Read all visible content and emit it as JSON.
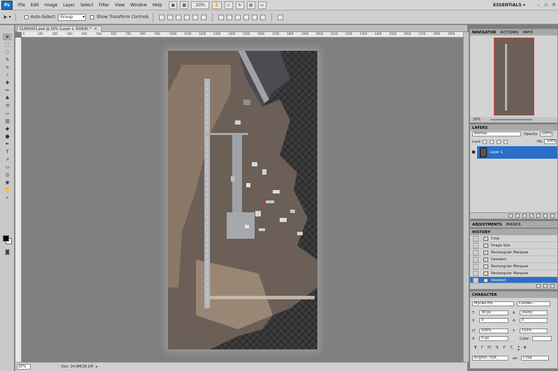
{
  "app": {
    "logo": "Ps"
  },
  "menu": [
    "File",
    "Edit",
    "Image",
    "Layer",
    "Select",
    "Filter",
    "View",
    "Window",
    "Help"
  ],
  "toolbar": {
    "zoom": "20%",
    "workspace": "ESSENTIALS",
    "workspace_arrow": "▾",
    "minimize": "–",
    "maximize": "▫",
    "close": "✕"
  },
  "options": {
    "auto_select_label": "Auto-Select:",
    "auto_select_value": "Group",
    "show_transform_label": "Show Transform Controls"
  },
  "document": {
    "tab_title": "ULKK0001.psd @ 20% (Layer 1, RGB/8) *",
    "ruler_marks": [
      "0",
      "100",
      "200",
      "300",
      "400",
      "500",
      "600",
      "700",
      "800",
      "900",
      "1000",
      "1100",
      "1200",
      "1300",
      "1400",
      "1500",
      "1600",
      "1700",
      "1800",
      "1900",
      "2000",
      "2100",
      "2200",
      "2300",
      "2400",
      "2500",
      "2600",
      "2700",
      "2800",
      "2900"
    ]
  },
  "status": {
    "zoom": "20%",
    "doc": "Doc: 24.9M/28.1M"
  },
  "navigator": {
    "tabs": [
      "NAVIGATOR",
      "ACTIONS",
      "INFO"
    ],
    "zoom": "20%"
  },
  "layers": {
    "tabs": [
      "LAYERS"
    ],
    "blend_mode": "Normal",
    "opacity_label": "Opacity:",
    "opacity_value": "100%",
    "lock_label": "Lock:",
    "fill_label": "Fill:",
    "fill_value": "100%",
    "items": [
      {
        "name": "Layer 1"
      }
    ]
  },
  "adjustments": {
    "tabs": [
      "ADJUSTMENTS",
      "MASKS"
    ]
  },
  "history": {
    "tabs": [
      "HISTORY"
    ],
    "items": [
      "Crop",
      "Image Size",
      "Rectangular Marquee",
      "Deselect",
      "Rectangular Marquee",
      "Rectangular Marquee",
      "Deselect"
    ],
    "selected_index": 6
  },
  "character": {
    "tabs": [
      "CHARACTER"
    ],
    "font_family": "Myriad Pro",
    "font_style": "Conden...",
    "font_size": "30 px",
    "leading": "(Auto)",
    "kerning": "0",
    "tracking": "0",
    "vscale": "100%",
    "hscale": "110%",
    "baseline": "0 px",
    "color_label": "Color:",
    "styles": [
      "T",
      "T",
      "TT",
      "Tr",
      "T'",
      "T,",
      "T",
      "T"
    ],
    "language": "English: USA",
    "antialias": "Crisp"
  },
  "colors": {
    "selection": "#2a6fc9",
    "panel": "#d3d3d3",
    "canvas": "#7f7f7f"
  }
}
